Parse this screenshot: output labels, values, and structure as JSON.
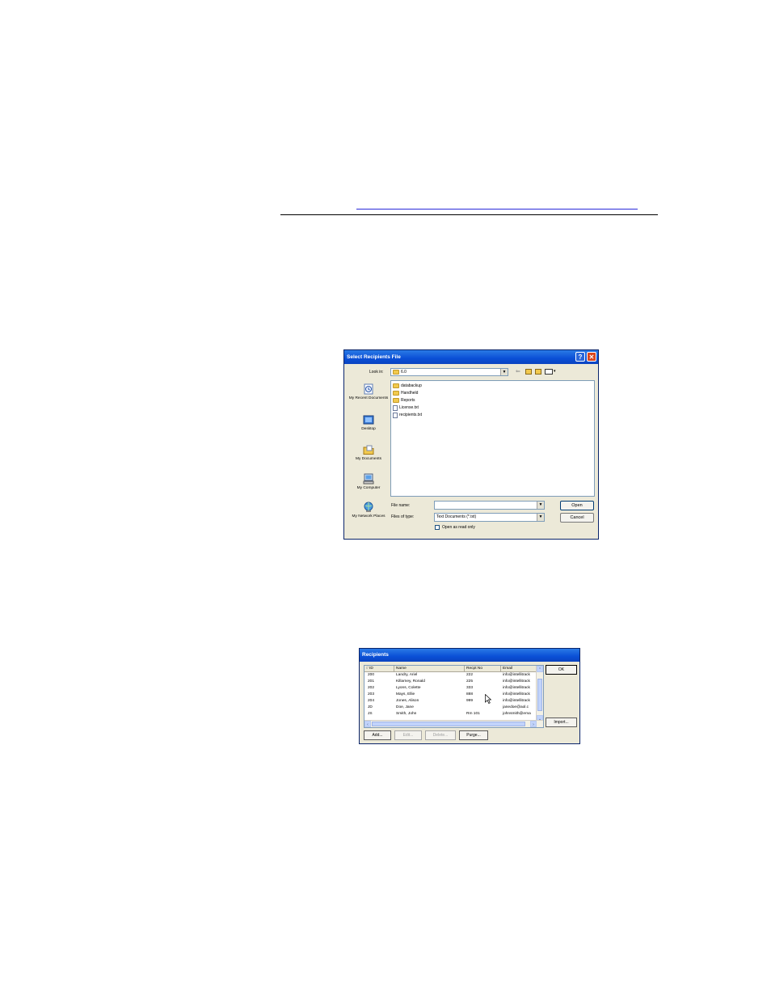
{
  "dialog_open": {
    "title": "Select Recipients File",
    "look_in_label": "Look in:",
    "look_in_value": "6.0",
    "places": [
      {
        "label": "My Recent Documents",
        "icon": "recent-documents-icon"
      },
      {
        "label": "Desktop",
        "icon": "desktop-icon"
      },
      {
        "label": "My Documents",
        "icon": "my-documents-icon"
      },
      {
        "label": "My Computer",
        "icon": "my-computer-icon"
      },
      {
        "label": "My Network Places",
        "icon": "network-places-icon"
      }
    ],
    "files": [
      {
        "name": "databackup",
        "type": "folder"
      },
      {
        "name": "Handheld",
        "type": "folder"
      },
      {
        "name": "Reports",
        "type": "folder"
      },
      {
        "name": "License.txt",
        "type": "text"
      },
      {
        "name": "recipients.txt",
        "type": "text"
      }
    ],
    "file_name_label": "File name:",
    "file_name_value": "",
    "files_of_type_label": "Files of type:",
    "files_of_type_value": "Text Documents (*.txt)",
    "open_read_only_label": "Open as read only",
    "open_button": "Open",
    "cancel_button": "Cancel"
  },
  "dialog_recipients": {
    "title": "Recipients",
    "columns": [
      "ID",
      "Name",
      "Recpt No",
      "Email"
    ],
    "rows": [
      [
        "200",
        "Landry, Ariel",
        "222",
        "info@intellitrack"
      ],
      [
        "201",
        "Killarney, Ronald",
        "225",
        "info@intellitrack"
      ],
      [
        "202",
        "Lyons, Colette",
        "333",
        "info@intellitrack"
      ],
      [
        "203",
        "Mays, Ellie",
        "888",
        "info@intellitrack"
      ],
      [
        "204",
        "Jones, Alison",
        "999",
        "info@intellitrack"
      ],
      [
        "JD",
        "Doe, Jane",
        "",
        "janedoe@aol.c"
      ],
      [
        "JS",
        "Smith, John",
        "Rm 101",
        "johnsmith@ema"
      ]
    ],
    "ok_button": "OK",
    "import_button": "Import...",
    "add_button": "Add...",
    "edit_button": "Edit...",
    "delete_button": "Delete...",
    "purge_button": "Purge..."
  }
}
